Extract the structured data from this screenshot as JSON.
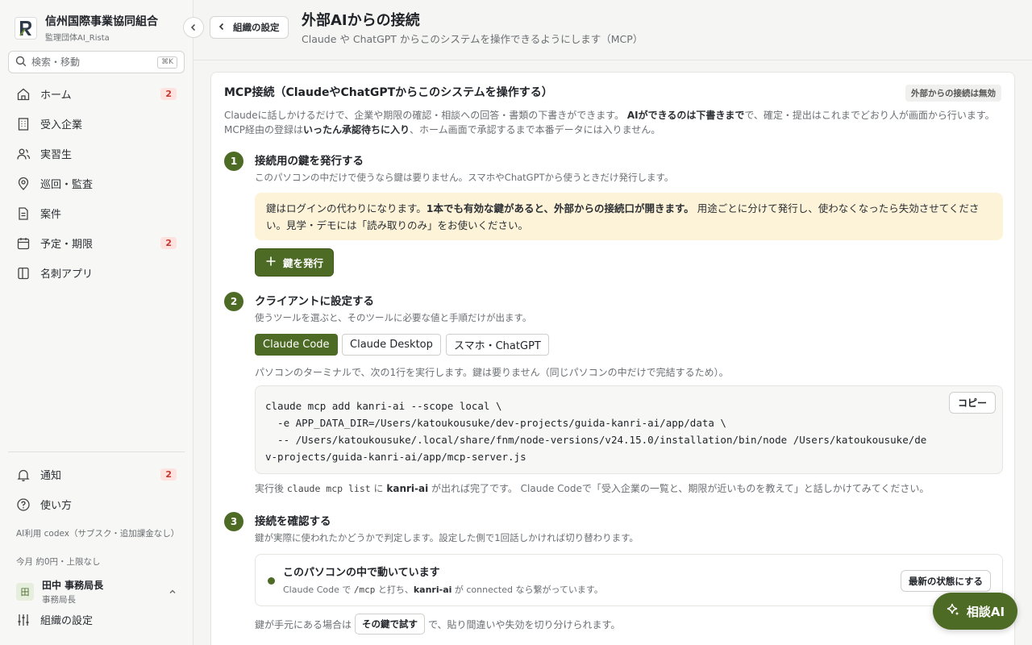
{
  "brand": {
    "name": "信州国際事業協同組合",
    "subtitle": "監理団体AI_Rista",
    "logo_letter": "R"
  },
  "search": {
    "placeholder": "検索・移動",
    "shortcut": "⌘K"
  },
  "nav": [
    {
      "label": "ホーム",
      "icon": "home-icon",
      "badge": "2"
    },
    {
      "label": "受入企業",
      "icon": "building-icon",
      "badge": ""
    },
    {
      "label": "実習生",
      "icon": "users-icon",
      "badge": ""
    },
    {
      "label": "巡回・監査",
      "icon": "map-pin-icon",
      "badge": ""
    },
    {
      "label": "案件",
      "icon": "document-icon",
      "badge": ""
    },
    {
      "label": "予定・期限",
      "icon": "calendar-icon",
      "badge": "2"
    },
    {
      "label": "名刺アプリ",
      "icon": "card-icon",
      "badge": ""
    }
  ],
  "bottom_nav": [
    {
      "label": "通知",
      "icon": "bell-icon",
      "badge": "2"
    },
    {
      "label": "使い方",
      "icon": "help-icon",
      "badge": ""
    }
  ],
  "ai_usage": {
    "line1": "AI利用 codex（サブスク・追加課金なし）",
    "line2": "今月 約0円・上限なし"
  },
  "user": {
    "avatar": "田",
    "name": "田中 事務局長",
    "role": "事務局長"
  },
  "org_settings_label": "組織の設定",
  "header": {
    "back_label": "組織の設定",
    "title": "外部AIからの接続",
    "subtitle": "Claude や ChatGPT からこのシステムを操作できるようにします（MCP）"
  },
  "card": {
    "title": "MCP接続（ClaudeやChatGPTからこのシステムを操作する）",
    "status": "外部からの接続は無効",
    "intro": {
      "line1_a": "Claudeに話しかけるだけで、企業や期限の確認・相談への回答・書類の下書きができます。",
      "line1_b": "AIができるのは下書きまで",
      "line1_c": "で、確定・提出はこれまでどおり人が画面から行います。",
      "line2_a": "MCP経由の登録は",
      "line2_b": "いったん承認待ちに入り",
      "line2_c": "、ホーム画面で承認するまで本番データには入りません。"
    }
  },
  "step1": {
    "num": "1",
    "title": "接続用の鍵を発行する",
    "desc": "このパソコンの中だけで使うなら鍵は要りません。スマホやChatGPTから使うときだけ発行します。",
    "warn_a": "鍵はログインの代わりになります。",
    "warn_b": "1本でも有効な鍵があると、外部からの接続口が開きます。",
    "warn_c": "用途ごとに分けて発行し、使わなくなったら失効させてください。見学・デモには「読み取りのみ」をお使いください。",
    "button": "鍵を発行"
  },
  "step2": {
    "num": "2",
    "title": "クライアントに設定する",
    "desc": "使うツールを選ぶと、そのツールに必要な値と手順だけが出ます。",
    "tabs": [
      "Claude Code",
      "Claude Desktop",
      "スマホ・ChatGPT"
    ],
    "instruction": "パソコンのターミナルで、次の1行を実行します。鍵は要りません（同じパソコンの中だけで完結するため）。",
    "code": "claude mcp add kanri-ai --scope local \\\n  -e APP_DATA_DIR=/Users/katoukousuke/dev-projects/guida-kanri-ai/app/data \\\n  -- /Users/katoukousuke/.local/share/fnm/node-versions/v24.15.0/installation/bin/node /Users/katoukousuke/de\nv-projects/guida-kanri-ai/app/mcp-server.js",
    "copy": "コピー",
    "after_a": "実行後",
    "after_code": "claude mcp list",
    "after_b": "に",
    "after_name": "kanri-ai",
    "after_c": "が出れば完了です。 Claude Codeで「受入企業の一覧と、期限が近いものを教えて」と話しかけてみてください。"
  },
  "step3": {
    "num": "3",
    "title": "接続を確認する",
    "desc": "鍵が実際に使われたかどうかで判定します。設定した側で1回話しかければ切り替わります。",
    "status_title": "このパソコンの中で動いています",
    "status_a": "Claude Code で",
    "status_code": "/mcp",
    "status_b": "と打ち、",
    "status_name": "kanri-ai",
    "status_c": "が connected なら繋がっています。",
    "refresh": "最新の状態にする",
    "test_a": "鍵が手元にある場合は",
    "test_button": "その鍵で試す",
    "test_b": "で、貼り間違いや失効を切り分けられます。"
  },
  "fab": {
    "label": "相談AI"
  },
  "colors": {
    "accent": "#4e6b25",
    "badge_bg": "#fde2e0",
    "badge_text": "#c23a2f",
    "warn_bg": "#fdf3d8"
  }
}
